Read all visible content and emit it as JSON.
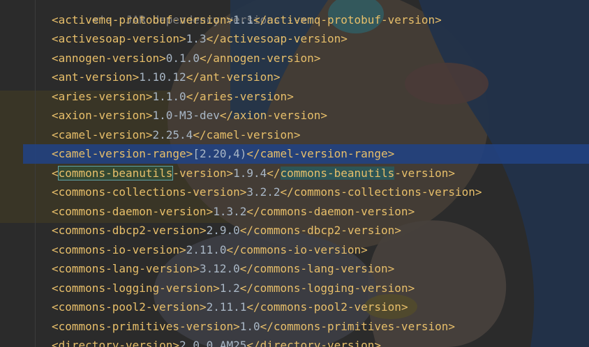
{
  "editor": {
    "comment_line": "<!-- JAR dependency versions -->",
    "lines": [
      {
        "tag": "activemq-protobuf-version",
        "value": "1.1"
      },
      {
        "tag": "activesoap-version",
        "value": "1.3"
      },
      {
        "tag": "annogen-version",
        "value": "0.1.0"
      },
      {
        "tag": "ant-version",
        "value": "1.10.12"
      },
      {
        "tag": "aries-version",
        "value": "1.1.0"
      },
      {
        "tag": "axion-version",
        "value": "1.0-M3-dev"
      },
      {
        "tag": "camel-version",
        "value": "2.25.4"
      },
      {
        "tag": "camel-version-range",
        "value": "[2.20,4)"
      },
      {
        "tag": "commons-beanutils-version",
        "value": "1.9.4"
      },
      {
        "tag": "commons-collections-version",
        "value": "3.2.2"
      },
      {
        "tag": "commons-daemon-version",
        "value": "1.3.2"
      },
      {
        "tag": "commons-dbcp2-version",
        "value": "2.9.0"
      },
      {
        "tag": "commons-io-version",
        "value": "2.11.0"
      },
      {
        "tag": "commons-lang-version",
        "value": "3.12.0"
      },
      {
        "tag": "commons-logging-version",
        "value": "1.2"
      },
      {
        "tag": "commons-pool2-version",
        "value": "2.11.1"
      },
      {
        "tag": "commons-primitives-version",
        "value": "1.0"
      },
      {
        "tag": "directory-version",
        "value": "2.0.0.AM25"
      }
    ],
    "highlight_word": "commons-beanutils",
    "colors": {
      "background": "#2b2b2b",
      "tag": "#e8bf6a",
      "text": "#a9b7c6",
      "comment": "#808080",
      "current_line": "#214283"
    }
  }
}
